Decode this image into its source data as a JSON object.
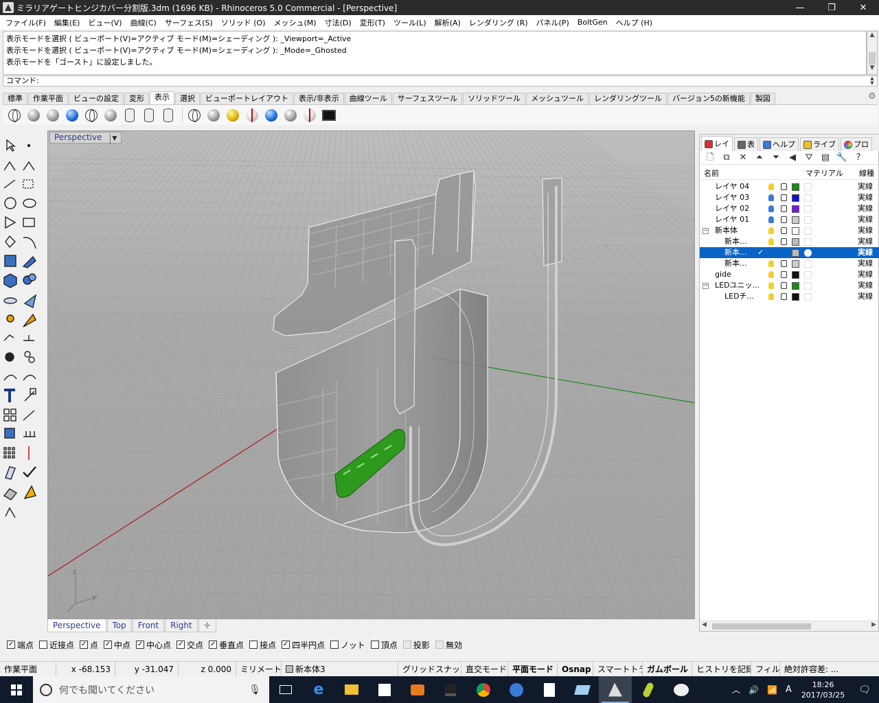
{
  "window": {
    "title": "ミラリアゲートヒンジカバー分割版.3dm (1696 KB) - Rhinoceros 5.0 Commercial - [Perspective]",
    "minimize": "—",
    "restore": "❐",
    "close": "✕"
  },
  "menu": [
    "ファイル(F)",
    "編集(E)",
    "ビュー(V)",
    "曲線(C)",
    "サーフェス(S)",
    "ソリッド (O)",
    "メッシュ(M)",
    "寸法(D)",
    "変形(T)",
    "ツール(L)",
    "解析(A)",
    "レンダリング (R)",
    "パネル(P)",
    "BoltGen",
    "ヘルプ (H)"
  ],
  "command": {
    "history": [
      "表示モードを選択 ( ビューポート(V)=アクティブ  モード(M)=シェーディング ): _Viewport=_Active",
      "表示モードを選択 ( ビューポート(V)=アクティブ  モード(M)=シェーディング ): _Mode=_Ghosted",
      "表示モードを「ゴースト」に設定しました。"
    ],
    "prompt": "コマンド:"
  },
  "toolbar_tabs": [
    "標準",
    "作業平面",
    "ビューの設定",
    "変形",
    "表示",
    "選択",
    "ビューポートレイアウト",
    "表示/非表示",
    "曲線ツール",
    "サーフェスツール",
    "ソリッドツール",
    "メッシュツール",
    "レンダリングツール",
    "バージョン5の新機能",
    "製図"
  ],
  "active_toolbar_tab": "表示",
  "viewport": {
    "title": "Perspective",
    "dropdown": "▼",
    "axis_labels": {
      "z": "z",
      "y": "y"
    },
    "tabs": [
      "Perspective",
      "Top",
      "Front",
      "Right"
    ],
    "add_tab": "✛"
  },
  "panel": {
    "tabs": [
      "レイ",
      "表",
      "ヘルプ",
      "ライブ",
      "プロ"
    ],
    "columns": {
      "name": "名前",
      "material": "マテリアル",
      "linetype": "線種"
    },
    "layers": [
      {
        "name": "レイヤ 04",
        "indent": 1,
        "color": "#1a8a1a",
        "bulb": "#f2d02a",
        "linetype": "実線"
      },
      {
        "name": "レイヤ 03",
        "indent": 1,
        "color": "#1010d8",
        "bulb": "#3a7ad8",
        "linetype": "実線"
      },
      {
        "name": "レイヤ 02",
        "indent": 1,
        "color": "#7a1ad8",
        "bulb": "#3a7ad8",
        "linetype": "実線"
      },
      {
        "name": "レイヤ 01",
        "indent": 1,
        "color": "#cccccc",
        "bulb": "#3a7ad8",
        "linetype": "実線"
      },
      {
        "name": "新本体",
        "indent": 1,
        "color": "#ffffff",
        "bulb": "#f2d02a",
        "linetype": "実線",
        "expander": "−"
      },
      {
        "name": "新本...",
        "indent": 2,
        "color": "#bbbbbb",
        "bulb": "#f2d02a",
        "linetype": "実線"
      },
      {
        "name": "新本...",
        "indent": 2,
        "color": "#bbbbbb",
        "bulb": "#f2d02a",
        "linetype": "実線",
        "selected": true,
        "current": "✓"
      },
      {
        "name": "新本...",
        "indent": 2,
        "color": "#cccccc",
        "bulb": "#f2d02a",
        "linetype": "実線"
      },
      {
        "name": "gide",
        "indent": 1,
        "color": "#111111",
        "bulb": "#f2d02a",
        "linetype": "実線"
      },
      {
        "name": "LEDユニッ...",
        "indent": 1,
        "color": "#1a8a1a",
        "bulb": "#f2d02a",
        "linetype": "実線",
        "expander": "−"
      },
      {
        "name": "LEDチ...",
        "indent": 2,
        "color": "#111111",
        "bulb": "#f2d02a",
        "linetype": "実線"
      }
    ]
  },
  "osnap": [
    {
      "label": "端点",
      "checked": true
    },
    {
      "label": "近接点",
      "checked": false
    },
    {
      "label": "点",
      "checked": true
    },
    {
      "label": "中点",
      "checked": true
    },
    {
      "label": "中心点",
      "checked": true
    },
    {
      "label": "交点",
      "checked": true
    },
    {
      "label": "垂直点",
      "checked": true
    },
    {
      "label": "接点",
      "checked": false
    },
    {
      "label": "四半円点",
      "checked": true
    },
    {
      "label": "ノット",
      "checked": false
    },
    {
      "label": "頂点",
      "checked": false
    },
    {
      "label": "投影",
      "checked": false,
      "disabled": true
    },
    {
      "label": "無効",
      "checked": false,
      "disabled": true
    }
  ],
  "status": {
    "cplane": "作業平面",
    "x": "x -68.153",
    "y": "y -31.047",
    "z": "z 0.000",
    "units": "ミリメートル",
    "layer": "新本体3",
    "grid_snap": "グリッドスナップ",
    "ortho": "直交モード",
    "planar": "平面モード",
    "osnap": "Osnap",
    "smarttrack": "スマートトラック",
    "gumball": "ガムボール",
    "history": "ヒストリを記録",
    "filter": "フィルタ",
    "tolerance": "絶対許容差: ..."
  },
  "taskbar": {
    "search_placeholder": "何でも聞いてください",
    "time": "18:26",
    "date": "2017/03/25",
    "ime": "A"
  }
}
